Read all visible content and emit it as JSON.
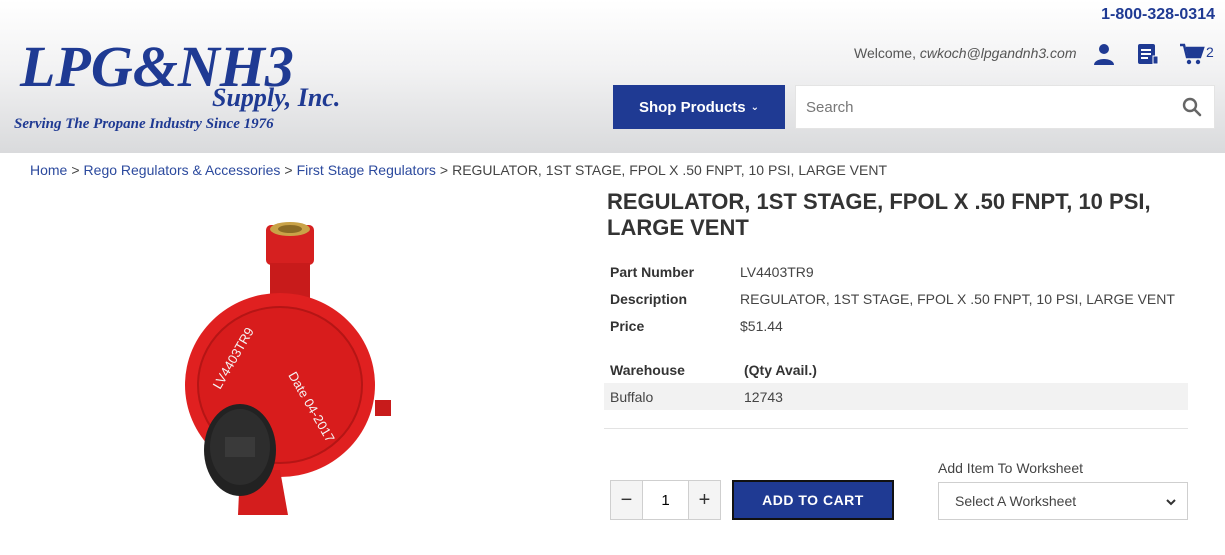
{
  "header": {
    "phone": "1-800-328-0314",
    "welcome_prefix": "Welcome,",
    "welcome_email": "cwkoch@lpgandnh3.com",
    "cart_count": "2",
    "shop_products_label": "Shop Products",
    "search_placeholder": "Search",
    "logo": {
      "line1": "LPG&NH3",
      "line2": "Supply, Inc.",
      "tagline": "Serving The Propane Industry Since 1976"
    }
  },
  "breadcrumb": {
    "items": [
      "Home",
      "Rego Regulators & Accessories",
      "First Stage Regulators"
    ],
    "current": "REGULATOR, 1ST STAGE, FPOL X .50 FNPT, 10 PSI, LARGE VENT",
    "separator": ">"
  },
  "product": {
    "title": "REGULATOR, 1ST STAGE, FPOL X .50 FNPT, 10 PSI, LARGE VENT",
    "details": [
      {
        "label": "Part Number",
        "value": "LV4403TR9"
      },
      {
        "label": "Description",
        "value": "REGULATOR, 1ST STAGE, FPOL X .50 FNPT, 10 PSI, LARGE VENT"
      },
      {
        "label": "Price",
        "value": "$51.44"
      }
    ],
    "warehouse": {
      "headers": [
        "Warehouse",
        "(Qty Avail.)"
      ],
      "rows": [
        {
          "name": "Buffalo",
          "qty": "12743"
        }
      ]
    },
    "image_text": {
      "model": "LV4403TR9",
      "date": "Date 04-2017"
    }
  },
  "purchase": {
    "quantity": "1",
    "minus_label": "−",
    "plus_label": "+",
    "add_to_cart_label": "ADD TO CART",
    "worksheet_label": "Add Item To Worksheet",
    "worksheet_select": "Select A Worksheet"
  },
  "colors": {
    "brand_blue": "#1f3a93",
    "link_blue": "#2c4a9e",
    "regulator_red": "#e02020"
  }
}
